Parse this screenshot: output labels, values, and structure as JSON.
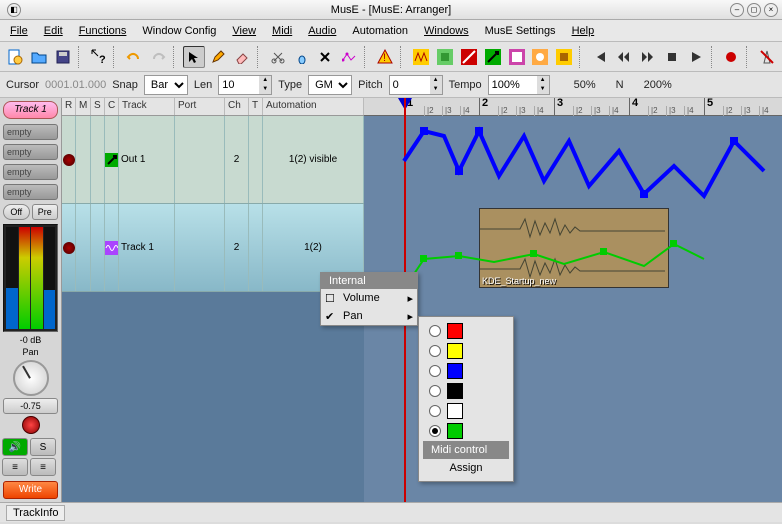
{
  "window": {
    "title": "MusE - [MusE: Arranger]"
  },
  "menus": [
    "File",
    "Edit",
    "Functions",
    "Window Config",
    "View",
    "Midi",
    "Audio",
    "Automation",
    "Windows",
    "MusE Settings",
    "Help"
  ],
  "params": {
    "cursor_label": "Cursor",
    "cursor_value": "0001.01.000",
    "snap_label": "Snap",
    "snap_value": "Bar",
    "len_label": "Len",
    "len_value": "10",
    "type_label": "Type",
    "type_value": "GM",
    "pitch_label": "Pitch",
    "pitch_value": "0",
    "tempo_label": "Tempo",
    "tempo_value": "100%",
    "zoom_a": "50%",
    "zoom_n": "N",
    "zoom_b": "200%"
  },
  "trackinfo": {
    "header": "Track 1",
    "slots": [
      "empty",
      "empty",
      "empty",
      "empty"
    ],
    "off_btn": "Off",
    "pre_btn": "Pre",
    "db": "-0 dB",
    "pan_label": "Pan",
    "pan_value": "-0.75",
    "write": "Write"
  },
  "tracklist": {
    "cols": [
      "R",
      "M",
      "S",
      "C",
      "Track",
      "Port",
      "Ch",
      "T",
      "Automation"
    ],
    "rows": [
      {
        "name": "Out 1",
        "ch": "2",
        "auto": "1(2) visible",
        "icon": "out",
        "selected": false
      },
      {
        "name": "Track 1",
        "ch": "2",
        "auto": "1(2)",
        "icon": "wave",
        "selected": true
      }
    ]
  },
  "ruler": {
    "bars": [
      "1",
      "2",
      "3",
      "4",
      "5"
    ],
    "sub": [
      "|2",
      "|3",
      "|4"
    ]
  },
  "clip": {
    "label": "KDE_Startup_new"
  },
  "context": {
    "header": "Internal",
    "items": [
      {
        "label": "Volume",
        "checked": false,
        "submenu": true
      },
      {
        "label": "Pan",
        "checked": true,
        "submenu": true
      }
    ]
  },
  "color_menu": {
    "colors": [
      "#ff0000",
      "#ffff00",
      "#0000ff",
      "#000000",
      "#ffffff",
      "#00cc00"
    ],
    "selected_index": 5,
    "midi_control": "Midi control",
    "assign": "Assign"
  },
  "status": {
    "trackinfo": "TrackInfo"
  }
}
